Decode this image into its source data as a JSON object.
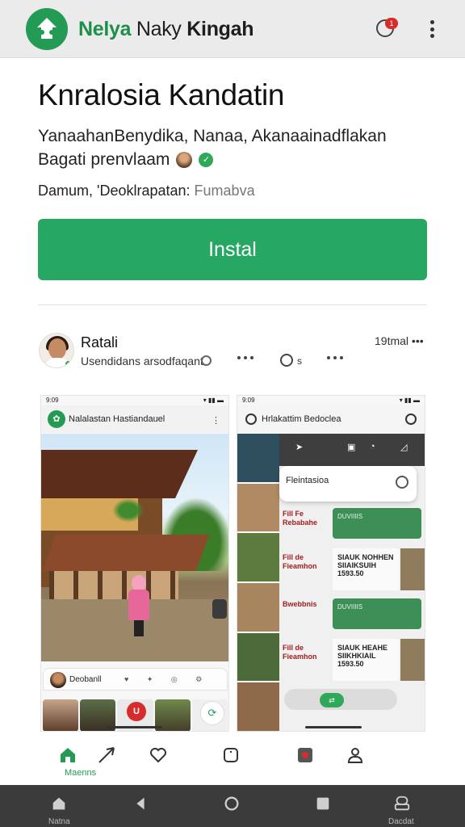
{
  "app": {
    "name_part1": "Nelya",
    "name_part2": "Naky",
    "name_part3": "Kingah",
    "notification_count": "1"
  },
  "header": {
    "title": "Knralosia Kandatin",
    "description_line1": "YanaahanBenydika, Nanaa, Akanaainadflakan",
    "description_line2": "Bagati prenvlaam",
    "meta_prefix": "Damum, 'Deoklrapatan:",
    "meta_suffix": "Fumabva",
    "install_label": "Instal"
  },
  "post": {
    "author_name": "Ratali",
    "author_sub": "Usendidans arsodfaqant",
    "comment_count": "s",
    "time": "19tmal"
  },
  "screenshot_left": {
    "status_time": "9:09",
    "app_title": "Nalalastan Hastiandauel",
    "story_name": "Deobanll"
  },
  "screenshot_right": {
    "status_time": "9:09",
    "app_title": "Hrlakattim Bedoclea",
    "popup_title": "Fleintasioa",
    "rows": [
      {
        "left": "Fill Fe Rebabahe",
        "box": "DUVIIIIS"
      },
      {
        "left": "Fill de Fieamhon",
        "box": "SIAUK NOHHEN SIIAIKSUIH 1593.50"
      },
      {
        "left": "Bwebbnis",
        "box": "DUVIIIIS"
      },
      {
        "left": "Fill de Fieamhon",
        "box": "SIAUK HEAHE SIIKHKIAIL 1593.50"
      }
    ]
  },
  "tabs": {
    "active_label": "Maenns"
  },
  "system_nav": {
    "home_label": "Natna",
    "right_label": "Dacdat"
  },
  "colors": {
    "brand_green": "#27a862",
    "appbar_bg": "#ebebeb",
    "navbar_bg": "#3b3b3b",
    "badge_red": "#d62c2c"
  }
}
